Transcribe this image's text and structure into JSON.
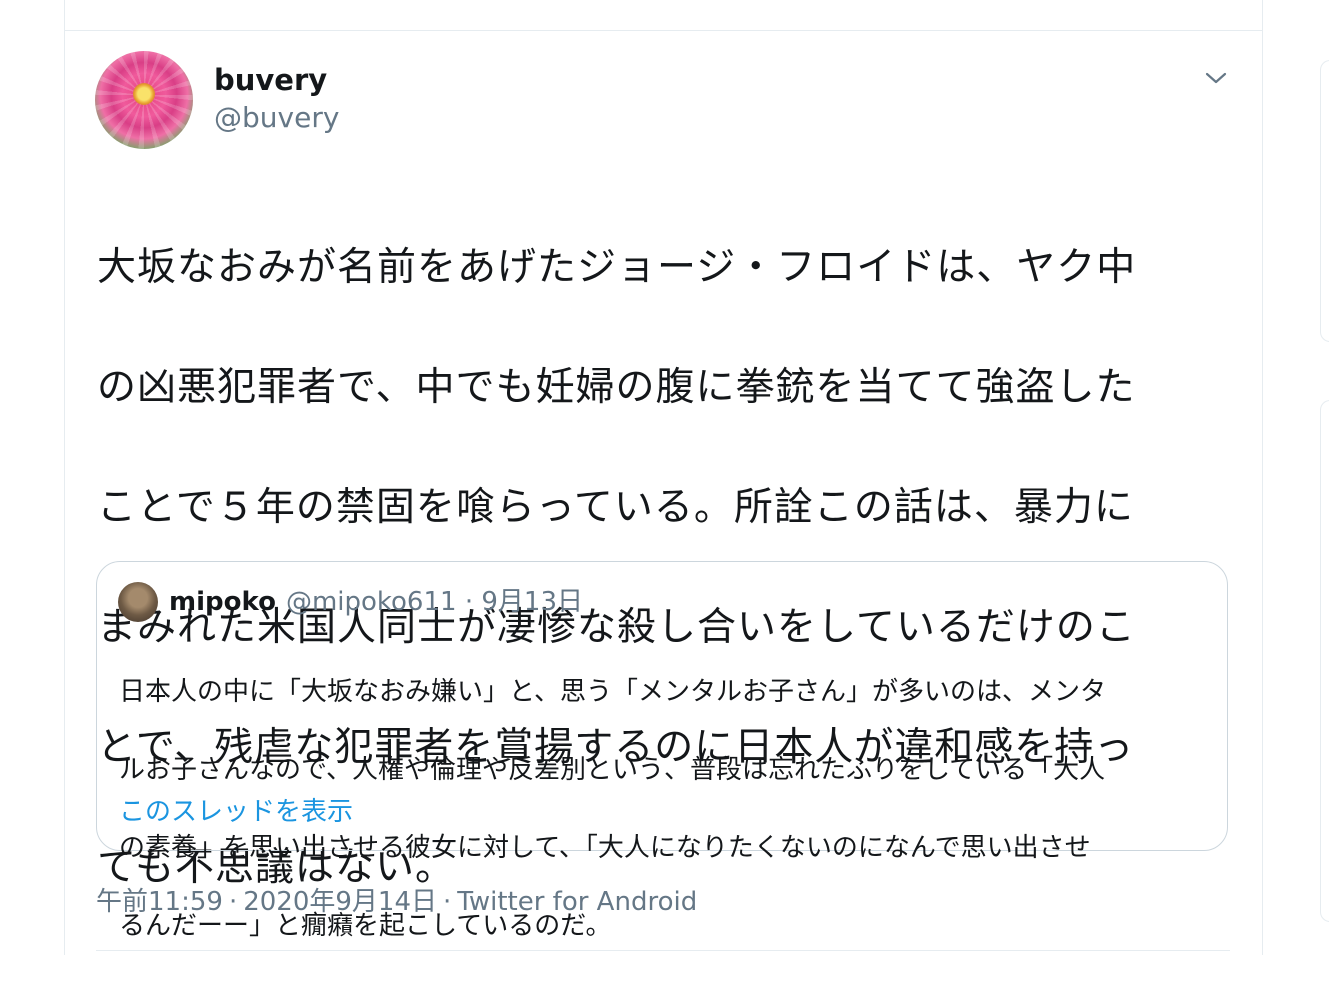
{
  "tweet": {
    "display_name": "buvery",
    "handle": "@buvery",
    "text_lines": [
      "大坂なおみが名前をあげたジョージ・フロイドは、ヤク中",
      "の凶悪犯罪者で、中でも妊婦の腹に拳銃を当てて強盗した",
      "ことで５年の禁固を喰らっている。所詮この話は、暴力に",
      "まみれた米国人同士が凄惨な殺し合いをしているだけのこ",
      "とで、残虐な犯罪者を賞揚するのに日本人が違和感を持っ",
      "ても不思議はない。"
    ],
    "time": "午前11:59",
    "date": "2020年9月14日",
    "source": "Twitter for Android",
    "separator": "·"
  },
  "quoted": {
    "display_name": "mipoko",
    "meta": "@mipoko611 · 9月13日",
    "text_lines": [
      "日本人の中に「大坂なおみ嫌い」と、思う「メンタルお子さん」が多いのは、メンタ",
      "ルお子さんなので、人権や倫理や反差別という、普段は忘れたふりをしている「大人",
      "の素養」を思い出させる彼女に対して、「大人になりたくないのになんで思い出させ",
      "るんだーー」と癇癪を起こしているのだ。"
    ],
    "show_thread": "このスレッドを表示"
  },
  "icons": {
    "more": "chevron-down-icon",
    "avatar": "avatar-image",
    "quoted_avatar": "avatar-image"
  },
  "colors": {
    "text": "#14171a",
    "secondary": "#657786",
    "link": "#1b95e0",
    "border": "#ccd6dd"
  }
}
